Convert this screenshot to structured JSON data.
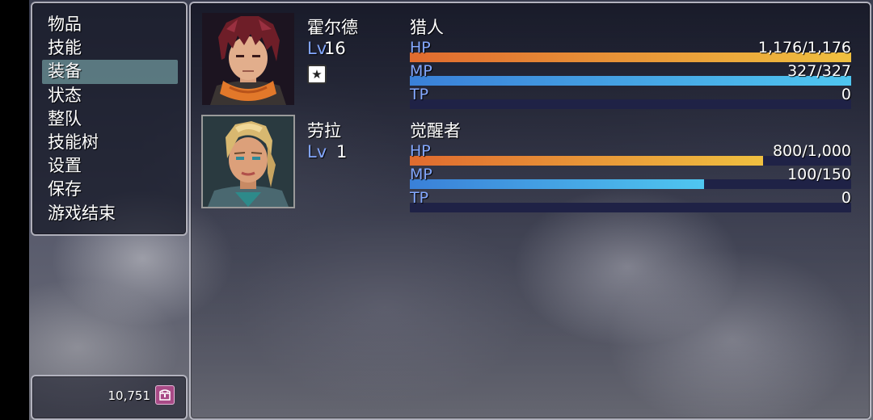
{
  "menu": {
    "items": [
      "物品",
      "技能",
      "装备",
      "状态",
      "整队",
      "技能树",
      "设置",
      "保存",
      "游戏结束"
    ],
    "selected_index": 2
  },
  "gold": {
    "value": "10,751",
    "icon": "treasure-chest-icon"
  },
  "actors": [
    {
      "name": "霍尔德",
      "level_label": "Lv",
      "level": "16",
      "class": "猎人",
      "state_icon": "star-icon",
      "state_glyph": "★",
      "hp": {
        "label": "HP",
        "text": "1,176/1,176",
        "current": 1176,
        "max": 1176
      },
      "mp": {
        "label": "MP",
        "text": "327/327",
        "current": 327,
        "max": 327
      },
      "tp": {
        "label": "TP",
        "text": "0",
        "current": 0,
        "max": 100
      }
    },
    {
      "name": "劳拉",
      "level_label": "Lv",
      "level": "1",
      "class": "觉醒者",
      "hp": {
        "label": "HP",
        "text": "800/1,000",
        "current": 800,
        "max": 1000
      },
      "mp": {
        "label": "MP",
        "text": "100/150",
        "current": 100,
        "max": 150
      },
      "tp": {
        "label": "TP",
        "text": "0",
        "current": 0,
        "max": 100
      }
    }
  ],
  "colors": {
    "hp_start": "#e06b2f",
    "hp_end": "#f0c040",
    "mp_start": "#3a80d8",
    "mp_end": "#4fc6f0",
    "system_label": "#84a8ff",
    "gauge_back": "#1f2246"
  }
}
